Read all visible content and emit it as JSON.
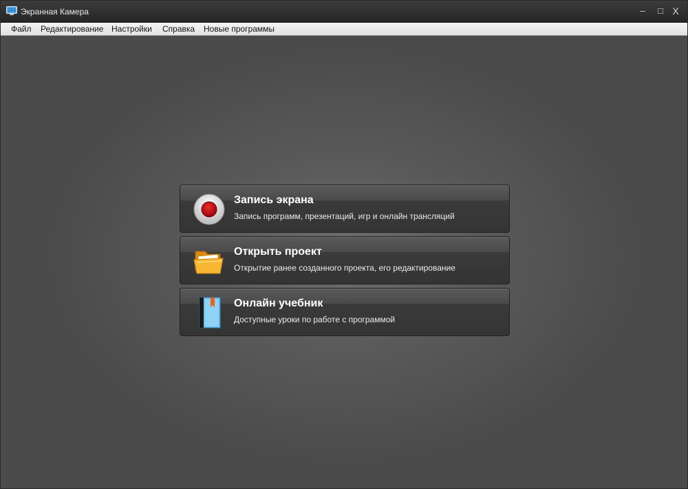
{
  "window": {
    "title": "Экранная Камера",
    "controls": {
      "minimize": "–",
      "maximize": "□",
      "close": "X"
    }
  },
  "menubar": {
    "items": [
      "Файл",
      "Редактирование",
      "Настройки",
      "Справка",
      "Новые программы"
    ]
  },
  "cards": [
    {
      "title": "Запись экрана",
      "subtitle": "Запись программ, презентаций, игр и онлайн трансляций",
      "icon": "record-icon"
    },
    {
      "title": "Открыть проект",
      "subtitle": "Открытие ранее созданного проекта, его редактирование",
      "icon": "folder-icon"
    },
    {
      "title": "Онлайн учебник",
      "subtitle": "Доступные уроки по работе с программой",
      "icon": "book-icon"
    }
  ],
  "colors": {
    "record_red": "#c4101a",
    "folder_orange": "#f5a623",
    "book_blue": "#5ab4e6",
    "bookmark_orange": "#e8631e"
  }
}
